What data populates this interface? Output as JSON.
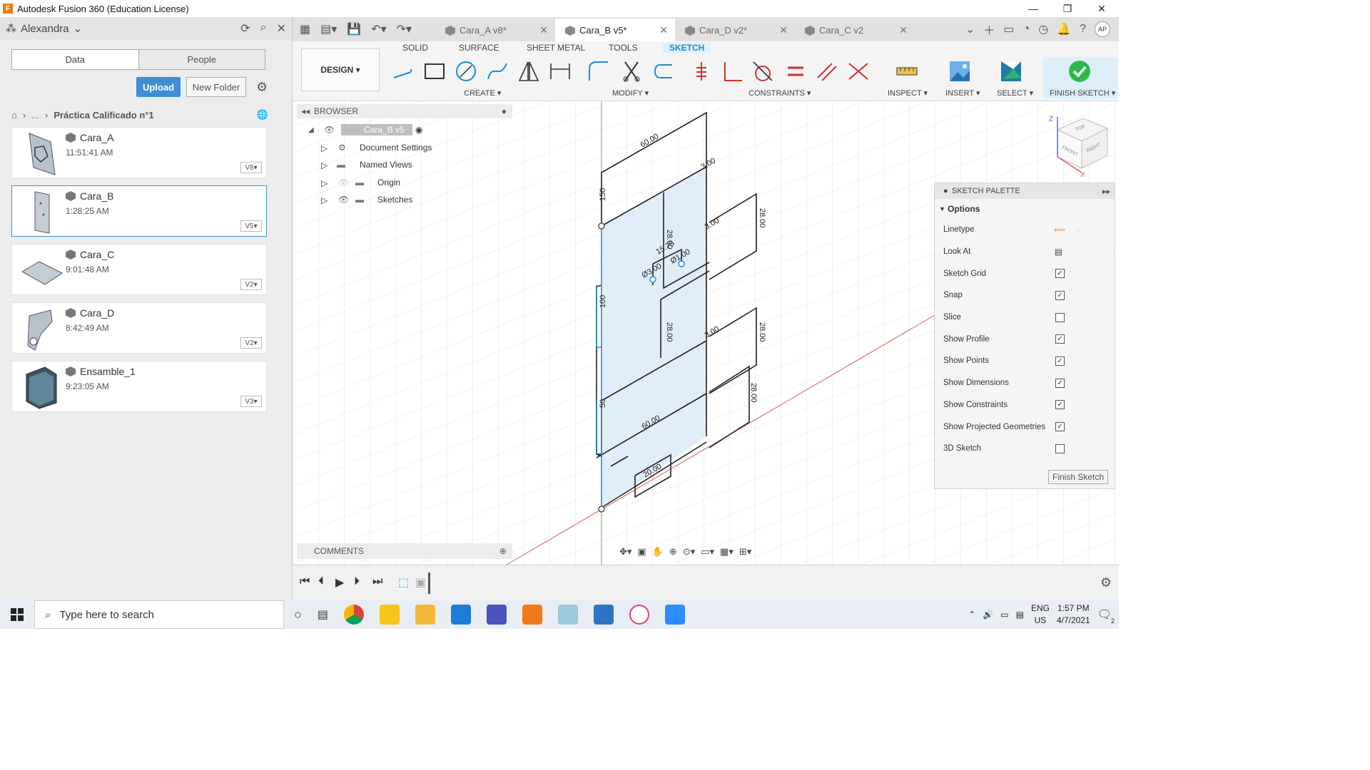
{
  "window": {
    "title": "Autodesk Fusion 360 (Education License)",
    "minimize": "—",
    "maximize": "❐",
    "close": "✕"
  },
  "datapanel": {
    "user": "Alexandra",
    "tabs": [
      "Data",
      "People"
    ],
    "upload_label": "Upload",
    "new_folder_label": "New Folder",
    "breadcrumb_ellipsis": "...",
    "breadcrumb_title": "Práctica Calificado n°1",
    "files": [
      {
        "name": "Cara_A",
        "time": "11:51:41 AM",
        "version": "V8"
      },
      {
        "name": "Cara_B",
        "time": "1:28:25 AM",
        "version": "V5"
      },
      {
        "name": "Cara_C",
        "time": "9:01:48 AM",
        "version": "V2"
      },
      {
        "name": "Cara_D",
        "time": "8:42:49 AM",
        "version": "V2"
      },
      {
        "name": "Ensamble_1",
        "time": "9:23:05 AM",
        "version": "V3"
      }
    ]
  },
  "doctabs": [
    {
      "label": "Cara_A v8*"
    },
    {
      "label": "Cara_B v5*"
    },
    {
      "label": "Cara_D v2*"
    },
    {
      "label": "Cara_C v2"
    }
  ],
  "avatar_initials": "AP",
  "toolbar": {
    "design_label": "DESIGN ▾",
    "workspace_tabs": [
      "SOLID",
      "SURFACE",
      "SHEET METAL",
      "TOOLS",
      "SKETCH"
    ],
    "groups": {
      "create": "CREATE ▾",
      "modify": "MODIFY ▾",
      "constraints": "CONSTRAINTS ▾",
      "inspect": "INSPECT ▾",
      "insert": "INSERT ▾",
      "select": "SELECT ▾",
      "finish": "FINISH SKETCH ▾"
    }
  },
  "browser": {
    "title": "BROWSER",
    "root": "Cara_B v5",
    "items": [
      "Document Settings",
      "Named Views",
      "Origin",
      "Sketches"
    ]
  },
  "comments_label": "COMMENTS",
  "sketch": {
    "dimensions": [
      "60.00",
      "150",
      "100",
      "50",
      "28.00",
      "28.00",
      "28.00",
      "28.00",
      "28.00",
      "15.75",
      "Ø3.00",
      "Ø1.00",
      "60.00",
      "20.00",
      "3.00",
      "3.00",
      "3.00"
    ]
  },
  "viewcube": {
    "top": "TOP",
    "front": "FRONT",
    "right": "RIGHT",
    "z": "Z",
    "x": "X"
  },
  "palette": {
    "title": "SKETCH PALETTE",
    "options_label": "Options",
    "rows": [
      {
        "label": "Linetype",
        "checked": null
      },
      {
        "label": "Look At",
        "checked": null
      },
      {
        "label": "Sketch Grid",
        "checked": true
      },
      {
        "label": "Snap",
        "checked": true
      },
      {
        "label": "Slice",
        "checked": false
      },
      {
        "label": "Show Profile",
        "checked": true
      },
      {
        "label": "Show Points",
        "checked": true
      },
      {
        "label": "Show Dimensions",
        "checked": true
      },
      {
        "label": "Show Constraints",
        "checked": true
      },
      {
        "label": "Show Projected Geometries",
        "checked": true
      },
      {
        "label": "3D Sketch",
        "checked": false
      }
    ],
    "finish_label": "Finish Sketch"
  },
  "taskbar": {
    "search_placeholder": "Type here to search",
    "lang": "ENG",
    "region": "US",
    "time": "1:57 PM",
    "date": "4/7/2021",
    "notifications": "2"
  },
  "colors": {
    "accent": "#1b8dd8",
    "upload": "#3e8fd6",
    "sketch_fill": "#dcebf8",
    "axis_red": "#e05a5a",
    "axis_green": "#5ac85a"
  }
}
